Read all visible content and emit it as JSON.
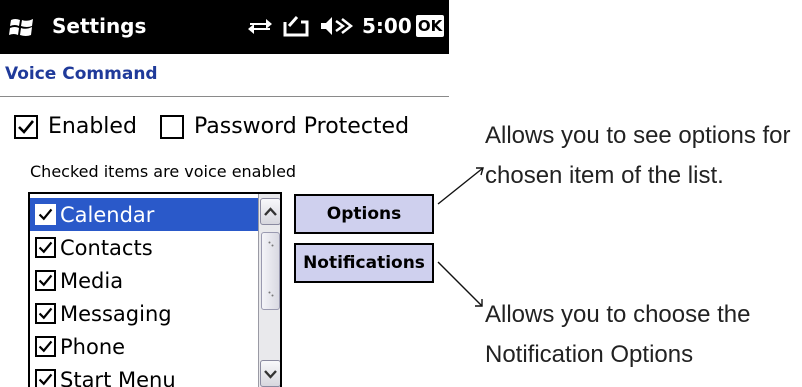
{
  "titlebar": {
    "title": "Settings",
    "time": "5:00",
    "ok_label": "OK",
    "icons": [
      "windows-logo-icon",
      "connectivity-icon",
      "battery-icon",
      "volume-icon"
    ]
  },
  "page": {
    "heading": "Voice Command"
  },
  "options": {
    "enabled": {
      "label": "Enabled",
      "checked": true
    },
    "password_protected": {
      "label": "Password Protected",
      "checked": false
    }
  },
  "list": {
    "hint": "Checked items are voice enabled",
    "items": [
      {
        "label": "Calendar",
        "checked": true,
        "selected": true
      },
      {
        "label": "Contacts",
        "checked": true,
        "selected": false
      },
      {
        "label": "Media",
        "checked": true,
        "selected": false
      },
      {
        "label": "Messaging",
        "checked": true,
        "selected": false
      },
      {
        "label": "Phone",
        "checked": true,
        "selected": false
      },
      {
        "label": "Start Menu",
        "checked": true,
        "selected": false
      }
    ]
  },
  "buttons": {
    "options_label": "Options",
    "notifications_label": "Notifications"
  },
  "callouts": {
    "options_line1": "Allows you to see options for",
    "options_line2": "chosen item of the list.",
    "notifications_line1": "Allows you to choose the",
    "notifications_line2": "Notification Options"
  },
  "colors": {
    "heading": "#1f3a9a",
    "selection": "#2a59c9",
    "button_face": "#cfd0ee"
  }
}
